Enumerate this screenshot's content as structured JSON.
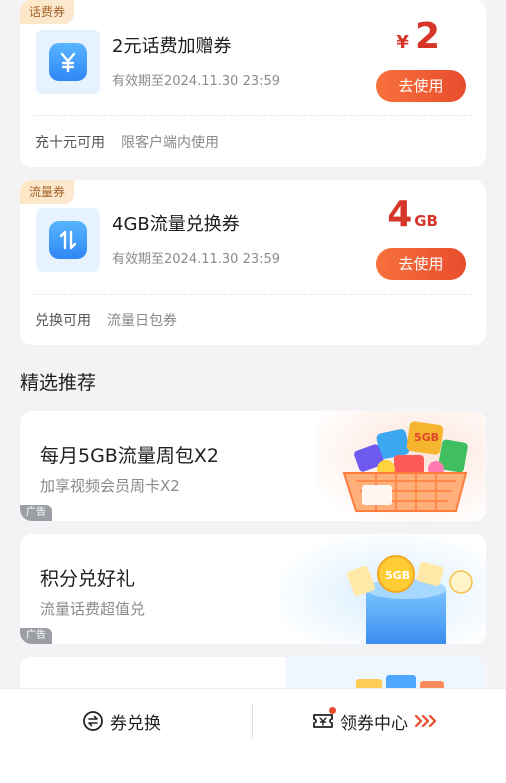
{
  "coupons": [
    {
      "tag": "话费券",
      "title": "2元话费加赠券",
      "validity": "有效期至2024.11.30 23:59",
      "value_prefix": "¥",
      "value": "2",
      "value_unit": "",
      "button": "去使用",
      "condition": "充十元可用",
      "scope": "限客户端内使用",
      "icon": "yuan-icon"
    },
    {
      "tag": "流量券",
      "title": "4GB流量兑换券",
      "validity": "有效期至2024.11.30 23:59",
      "value_prefix": "",
      "value": "4",
      "value_unit": "GB",
      "button": "去使用",
      "condition": "兑换可用",
      "scope": "流量日包券",
      "icon": "exchange-arrows-icon"
    }
  ],
  "section": {
    "title": "精选推荐"
  },
  "promos": [
    {
      "title": "每月5GB流量周包X2",
      "subtitle": "加享视频会员周卡X2",
      "ad": "广告",
      "art_label": "5GB"
    },
    {
      "title": "积分兑好礼",
      "subtitle": "流量话费超值兑",
      "ad": "广告",
      "art_label": "5GB"
    }
  ],
  "bottom_bar": {
    "exchange_label": "券兑换",
    "center_label": "领券中心",
    "colors": {
      "accent": "#e8482b"
    }
  }
}
